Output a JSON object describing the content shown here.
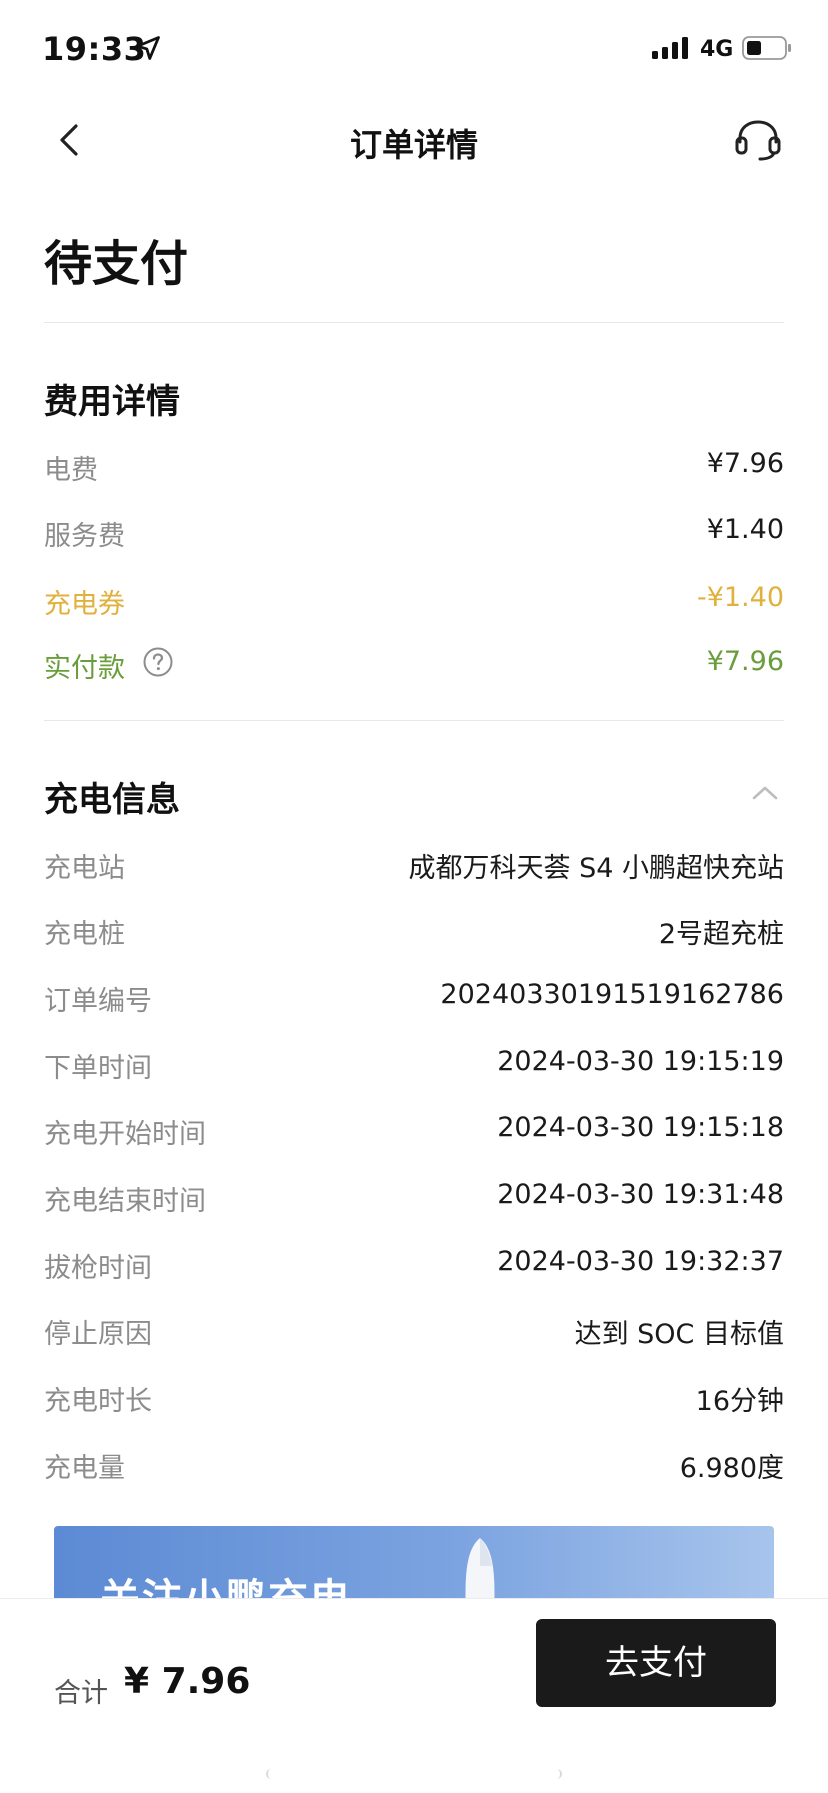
{
  "status_bar": {
    "time": "19:33",
    "network": "4G",
    "icons": [
      "location-arrow-icon",
      "signal-icon",
      "battery-icon"
    ]
  },
  "header": {
    "title": "订单详情",
    "icons": [
      "chevron-left-icon",
      "headset-icon"
    ]
  },
  "order_status": "待支付",
  "fee_section": {
    "title": "费用详情",
    "rows": [
      {
        "label": "电费",
        "value": "¥7.96"
      },
      {
        "label": "服务费",
        "value": "¥1.40"
      },
      {
        "label": "充电券",
        "value": "-¥1.40"
      },
      {
        "label": "实付款",
        "value": "¥7.96"
      }
    ]
  },
  "charge_section": {
    "title": "充电信息",
    "rows": [
      {
        "label": "充电站",
        "value": "成都万科天荟 S4 小鹏超快充站"
      },
      {
        "label": "充电桩",
        "value": "2号超充桩"
      },
      {
        "label": "订单编号",
        "value": "20240330191519162786"
      },
      {
        "label": "下单时间",
        "value": "2024-03-30 19:15:19"
      },
      {
        "label": "充电开始时间",
        "value": "2024-03-30 19:15:18"
      },
      {
        "label": "充电结束时间",
        "value": "2024-03-30 19:31:48"
      },
      {
        "label": "拔枪时间",
        "value": "2024-03-30 19:32:37"
      },
      {
        "label": "停止原因",
        "value": "达到 SOC 目标值"
      },
      {
        "label": "充电时长",
        "value": "16分钟"
      },
      {
        "label": "充电量",
        "value": "6.980度"
      }
    ]
  },
  "banner": {
    "text": "关注小鹏充电"
  },
  "bottom_bar": {
    "total_label": "合计",
    "total_value": "¥ 7.96",
    "pay_label": "去支付"
  },
  "colors": {
    "coupon": "#e0b13c",
    "paid": "#6a9e3c",
    "label_gray": "#8c8c8c",
    "button_dark": "#1a1a1a"
  }
}
